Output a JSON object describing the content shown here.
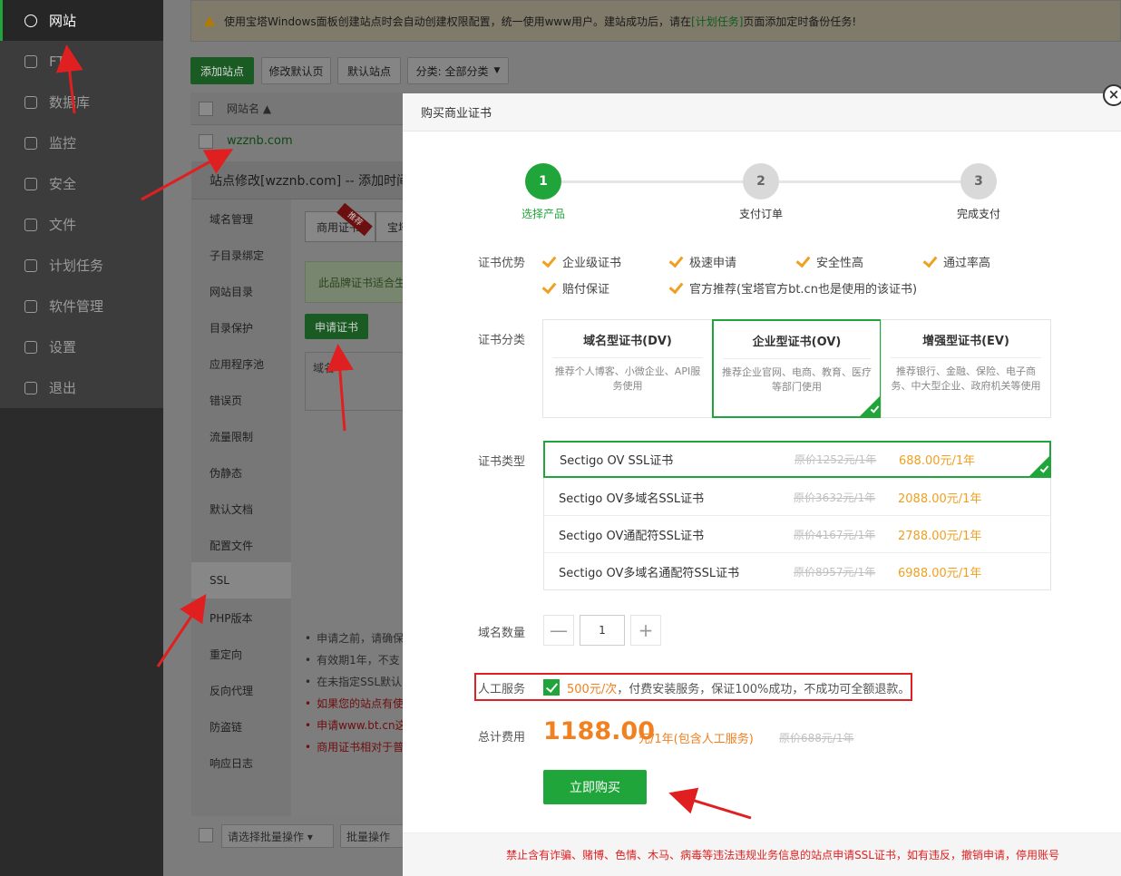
{
  "sidebar": {
    "items": [
      {
        "label": "网站",
        "icon": "globe-icon",
        "active": true
      },
      {
        "label": "FTP",
        "icon": "ftp-icon"
      },
      {
        "label": "数据库",
        "icon": "database-icon"
      },
      {
        "label": "监控",
        "icon": "monitor-icon"
      },
      {
        "label": "安全",
        "icon": "shield-icon"
      },
      {
        "label": "文件",
        "icon": "folder-icon"
      },
      {
        "label": "计划任务",
        "icon": "calendar-icon"
      },
      {
        "label": "软件管理",
        "icon": "apps-icon"
      },
      {
        "label": "设置",
        "icon": "gear-icon"
      },
      {
        "label": "退出",
        "icon": "logout-icon"
      }
    ]
  },
  "notice": {
    "pre": "使用宝塔Windows面板创建站点时会自动创建权限配置，统一使用www用户。建站成功后，请在",
    "link": "[计划任务]",
    "post": "页面添加定时备份任务!"
  },
  "toolbar": {
    "add_site": "添加站点",
    "modify_default": "修改默认页",
    "default_site": "默认站点",
    "category": "分类: 全部分类"
  },
  "site_table": {
    "col_name": "网站名 ▲",
    "row_name": "wzznb.com"
  },
  "site_dialog": {
    "title": "站点修改[wzznb.com] -- 添加时间",
    "menu": [
      "域名管理",
      "子目录绑定",
      "网站目录",
      "目录保护",
      "应用程序池",
      "错误页",
      "流量限制",
      "伪静态",
      "默认文档",
      "配置文件",
      "SSL",
      "PHP版本",
      "重定向",
      "反向代理",
      "防盗链",
      "响应日志"
    ],
    "tab_commercial": "商用证书",
    "tab_other": "宝塔",
    "recommend_tag": "推荐",
    "info": "此品牌证书适合生",
    "apply_btn": "申请证书",
    "table_col": "域名",
    "notes": [
      "申请之前，请确保",
      "有效期1年，不支",
      "在未指定SSL默认",
      "如果您的站点有使",
      "申请www.bt.cn这",
      "商用证书相对于普"
    ]
  },
  "bottom": {
    "batch_select": "请选择批量操作 ▾",
    "batch_btn": "批量操作"
  },
  "buy_dialog": {
    "title": "购买商业证书",
    "close": "×",
    "steps": [
      {
        "num": "1",
        "label": "选择产品"
      },
      {
        "num": "2",
        "label": "支付订单"
      },
      {
        "num": "3",
        "label": "完成支付"
      }
    ],
    "advantages_label": "证书优势",
    "advantages": [
      "企业级证书",
      "极速申请",
      "安全性高",
      "通过率高",
      "赔付保证",
      "官方推荐(宝塔官方bt.cn也是使用的该证书)"
    ],
    "category_label": "证书分类",
    "categories": [
      {
        "title": "域名型证书(DV)",
        "desc": "推荐个人博客、小微企业、API服务使用"
      },
      {
        "title": "企业型证书(OV)",
        "desc": "推荐企业官网、电商、教育、医疗等部门使用",
        "selected": true
      },
      {
        "title": "增强型证书(EV)",
        "desc": "推荐银行、金融、保险、电子商务、中大型企业、政府机关等使用"
      }
    ],
    "type_label": "证书类型",
    "products": [
      {
        "name": "Sectigo OV SSL证书",
        "orig": "原价1252元/1年",
        "price": "688.00元/1年",
        "selected": true
      },
      {
        "name": "Sectigo OV多域名SSL证书",
        "orig": "原价3632元/1年",
        "price": "2088.00元/1年"
      },
      {
        "name": "Sectigo OV通配符SSL证书",
        "orig": "原价4167元/1年",
        "price": "2788.00元/1年"
      },
      {
        "name": "Sectigo OV多域名通配符SSL证书",
        "orig": "原价8957元/1年",
        "price": "6988.00元/1年"
      }
    ],
    "qty_label": "域名数量",
    "qty_value": "1",
    "qty_minus": "—",
    "qty_plus": "+",
    "service_label": "人工服务",
    "service_price": "500元/次",
    "service_text": "，付费安装服务，保证100%成功，不成功可全额退款。",
    "total_label": "总计费用",
    "total_value": "1188.00",
    "total_unit": "元/1年(包含人工服务)",
    "total_orig": "原价688元/1年",
    "buy_btn": "立即购买",
    "footer": "禁止含有诈骗、赌博、色情、木马、病毒等违法违规业务信息的站点申请SSL证书，如有违反，撤销申请，停用账号"
  },
  "colors": {
    "accent": "#20a53a",
    "price": "#f08020",
    "warning": "#e02020",
    "annotation_arrow": "#e02020"
  }
}
